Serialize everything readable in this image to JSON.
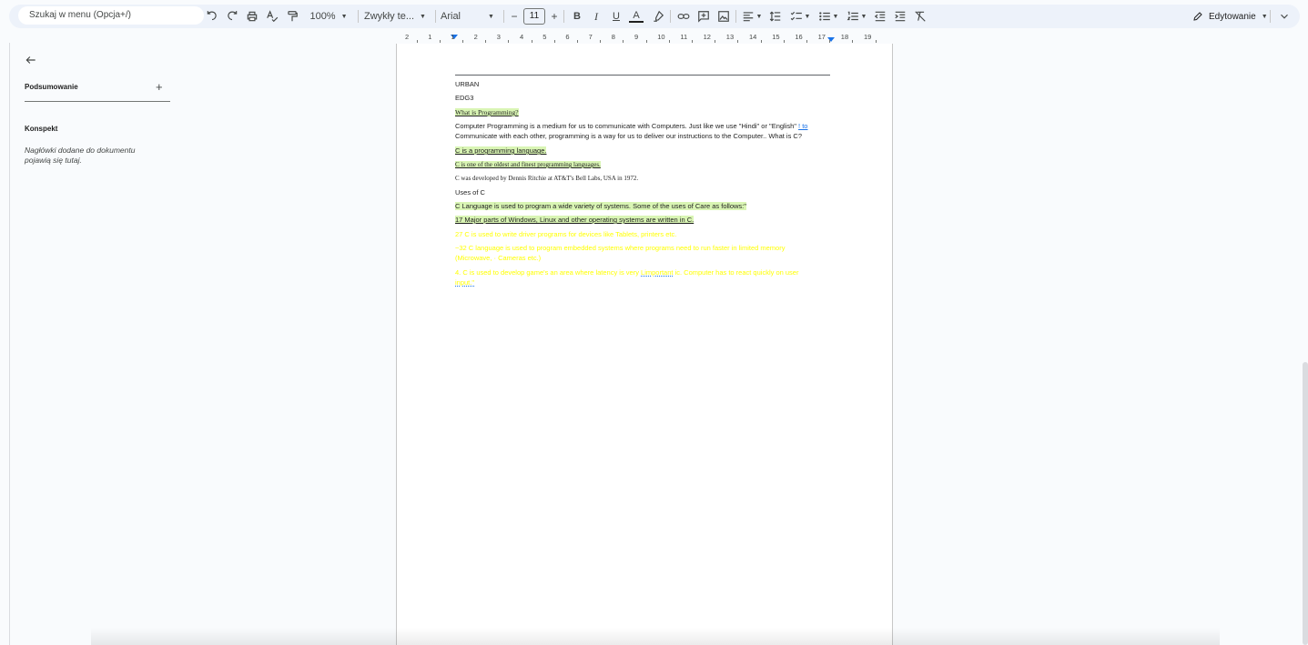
{
  "toolbar": {
    "search_placeholder": "Szukaj w menu (Opcja+/)",
    "zoom": "100%",
    "style": "Zwykły te...",
    "font": "Arial",
    "font_size": "11",
    "bold_label": "B",
    "italic_label": "I",
    "underline_label": "U",
    "text_color_label": "A",
    "minus_label": "−",
    "plus_label": "+",
    "mode": "Edytowanie"
  },
  "sidebar": {
    "summary_label": "Podsumowanie",
    "summary_add": "+",
    "outline_label": "Konspekt",
    "outline_hint": "Nagłówki dodane do dokumentu pojawią się tutaj."
  },
  "ruler": {
    "numbers": [
      "2",
      "1",
      "1",
      "2",
      "3",
      "4",
      "5",
      "6",
      "7",
      "8",
      "9",
      "10",
      "11",
      "12",
      "13",
      "14",
      "15",
      "16",
      "17",
      "18",
      "19"
    ]
  },
  "document": {
    "line1": "URBAN",
    "line2": "EDG3",
    "line3": "What is Programming?",
    "line4a": "Computer Programming is a medium for us to communicate with Computers. Just like we use \"Hindi\" or \"English\" ",
    "line4b": "! to",
    "line4c": "Communicate with each other, programming is a way for us to deliver our instructions to the Computer.. What is C?",
    "line5": "C is a programming language.",
    "line6": "C is one of the oldest and finest programming languages.",
    "line7": "C was developed by Dennis Ritchie at AT&T's Bell Labs, USA in 1972.",
    "line8": "Uses of C",
    "line9": "C Language is used to program a wide variety of systems. Some of the uses of Care as follows:\"",
    "line10": "17 Major parts of Windows, Linux and other operating systems are written in C.",
    "line11": "27 C is used to write driver programs for devices like Tablets, printers etc.",
    "line12a": "~32 C language is used to program embedded systems where programs need to run faster in limited memory",
    "line12b": "(Microwave, · Cameras etc.)",
    "line13a": "4. C is used to develop game's an area where latency is very ",
    "line13b": "Limportant",
    "line13c": " ic. Computer has to react quickly on user",
    "line13d": "input.\""
  }
}
